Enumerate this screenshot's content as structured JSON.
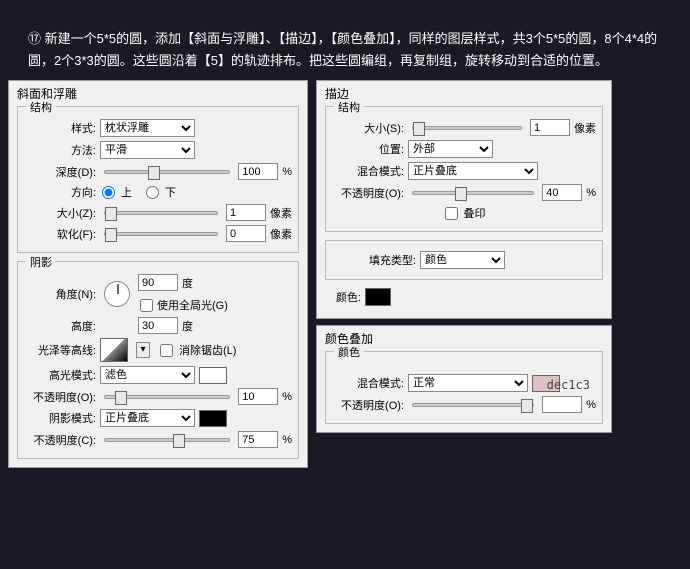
{
  "instruction": "⑰ 新建一个5*5的圆，添加【斜面与浮雕】、【描边】，【颜色叠加】，同样的图层样式，共3个5*5的圆，8个4*4的圆，2个3*3的圆。这些圆沿着【5】的轨迹排布。把这些圆编组，再复制组，旋转移动到合适的位置。",
  "bevel": {
    "title": "斜面和浮雕",
    "group_struct": "结构",
    "style_label": "样式:",
    "style": "枕状浮雕",
    "method_label": "方法:",
    "method": "平滑",
    "depth_label": "深度(D):",
    "depth": "100",
    "direction_label": "方向:",
    "dir_up": "上",
    "dir_down": "下",
    "size_label": "大小(Z):",
    "size": "1",
    "soften_label": "软化(F):",
    "soften": "0",
    "px": "像素",
    "pct": "%",
    "group_shadow": "阴影",
    "angle_label": "角度(N):",
    "angle": "90",
    "deg": "度",
    "global_light": "使用全局光(G)",
    "altitude_label": "高度:",
    "altitude": "30",
    "gloss_label": "光泽等高线:",
    "antialias": "消除锯齿(L)",
    "highlight_label": "高光模式:",
    "highlight_mode": "滤色",
    "opacity_label": "不透明度(O):",
    "hl_opacity": "10",
    "shadow_label": "阴影模式:",
    "shadow_mode": "正片叠底",
    "shadow_opacity_label": "不透明度(C):",
    "sh_opacity": "75"
  },
  "stroke": {
    "title": "描边",
    "group_struct": "结构",
    "size_label": "大小(S):",
    "size": "1",
    "px": "像素",
    "position_label": "位置:",
    "position": "外部",
    "blend_label": "混合模式:",
    "blend": "正片叠底",
    "opacity_label": "不透明度(O):",
    "opacity": "40",
    "pct": "%",
    "overprint": "叠印",
    "filltype_label": "填充类型:",
    "filltype": "颜色",
    "color_label": "颜色:",
    "color": "#000000"
  },
  "overlay": {
    "title": "颜色叠加",
    "group": "颜色",
    "hex": "dec1c3",
    "blend_label": "混合模式:",
    "blend": "正常",
    "opacity_label": "不透明度(O):",
    "opacity": "100",
    "pct": "%",
    "color": "#dec1c3"
  }
}
